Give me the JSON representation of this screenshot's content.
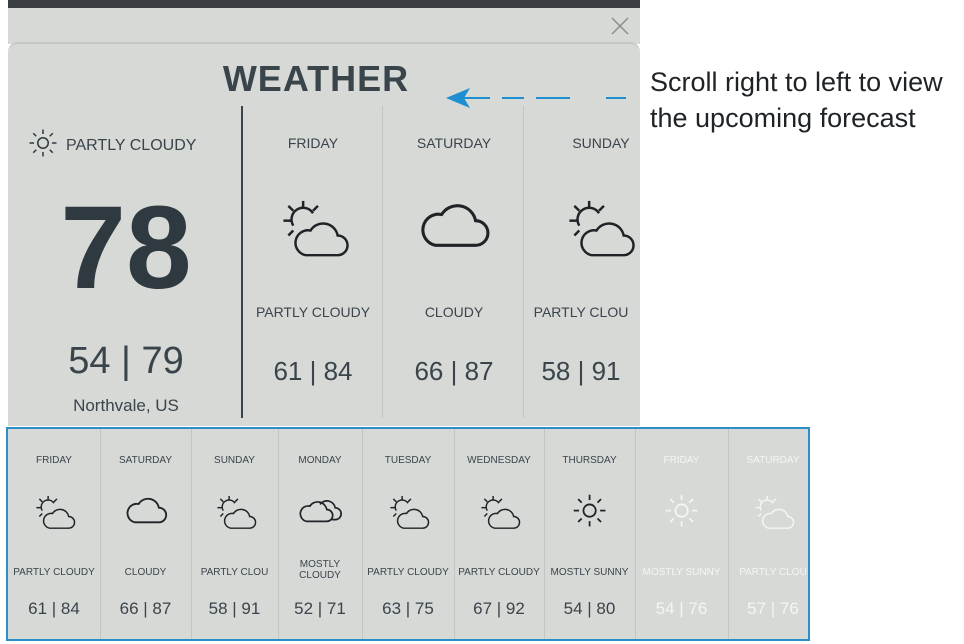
{
  "window": {
    "close_icon": "close-icon"
  },
  "widget": {
    "title": "WEATHER",
    "current": {
      "condition": "PARTLY CLOUDY",
      "icon": "sun-icon",
      "temperature": "78",
      "range": "54 | 79",
      "location": "Northvale, US"
    },
    "forecast": [
      {
        "day": "FRIDAY",
        "icon": "partly-cloudy-icon",
        "condition": "PARTLY CLOUDY",
        "range": "61 | 84"
      },
      {
        "day": "SATURDAY",
        "icon": "cloudy-icon",
        "condition": "CLOUDY",
        "range": "66 | 87"
      },
      {
        "day": "SUNDAY",
        "icon": "partly-cloudy-icon",
        "condition": "PARTLY CLOU",
        "range": "58 | 91"
      }
    ]
  },
  "annotation": {
    "text": "Scroll right to left to view the upcoming forecast",
    "arrow_color": "#1e8fd0"
  },
  "strip": {
    "border_color": "#2d8fc8",
    "days": [
      {
        "day": "FRIDAY",
        "icon": "partly-cloudy-icon",
        "condition": "PARTLY CLOUDY",
        "range": "61 | 84"
      },
      {
        "day": "SATURDAY",
        "icon": "cloudy-icon",
        "condition": "CLOUDY",
        "range": "66 | 87"
      },
      {
        "day": "SUNDAY",
        "icon": "partly-cloudy-icon",
        "condition": "PARTLY CLOU",
        "range": "58 | 91"
      },
      {
        "day": "MONDAY",
        "icon": "mostly-cloudy-icon",
        "condition": "MOSTLY CLOUDY",
        "range": "52 | 71"
      },
      {
        "day": "TUESDAY",
        "icon": "partly-cloudy-icon",
        "condition": "PARTLY CLOUDY",
        "range": "63 | 75"
      },
      {
        "day": "WEDNESDAY",
        "icon": "partly-cloudy-icon",
        "condition": "PARTLY CLOUDY",
        "range": "67 | 92"
      },
      {
        "day": "THURSDAY",
        "icon": "sun-icon",
        "condition": "MOSTLY SUNNY",
        "range": "54 | 80"
      },
      {
        "day": "FRIDAY",
        "icon": "sun-icon",
        "condition": "MOSTLY SUNNY",
        "range": "54 | 76"
      },
      {
        "day": "SATURDAY",
        "icon": "partly-cloudy-icon",
        "condition": "PARTLY CLOU",
        "range": "57 | 76"
      }
    ]
  }
}
